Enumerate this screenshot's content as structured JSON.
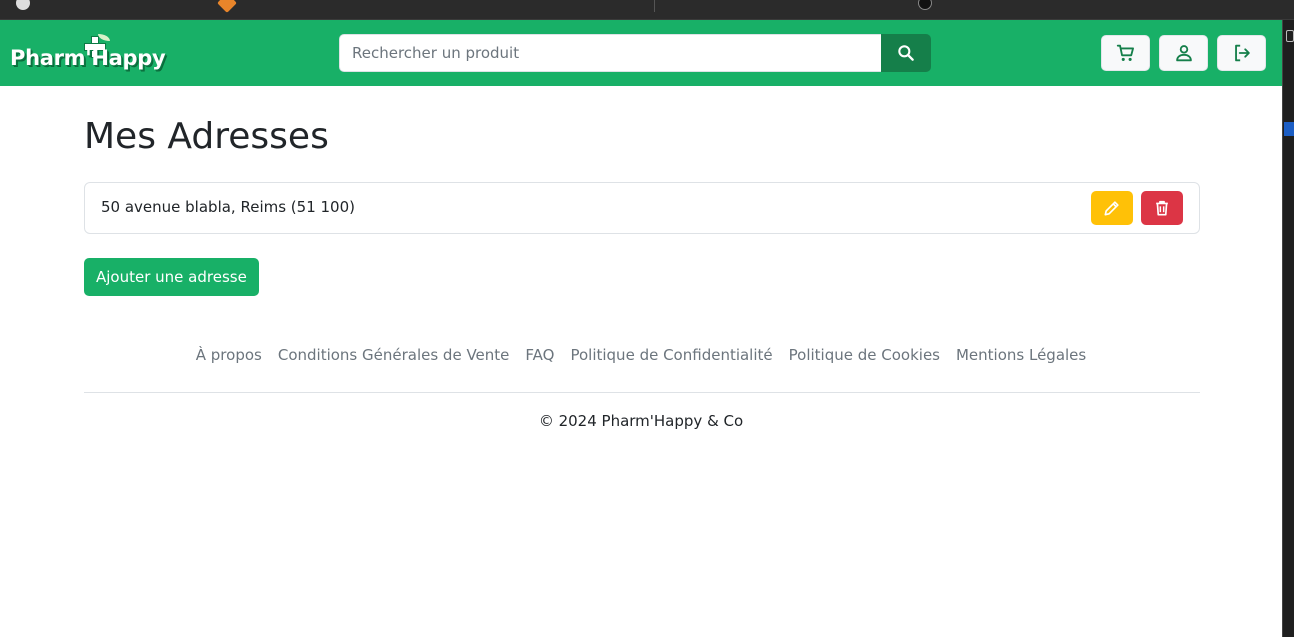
{
  "navbar": {
    "logo_text": "Pharm'Happy",
    "search_placeholder": "Rechercher un produit",
    "icons": {
      "search": "search-icon",
      "cart": "cart-icon",
      "account": "user-icon",
      "logout": "logout-icon"
    }
  },
  "main": {
    "title": "Mes Adresses",
    "addresses": [
      {
        "text": "50 avenue blabla, Reims (51 100)"
      }
    ],
    "add_button_label": "Ajouter une adresse"
  },
  "footer": {
    "links": [
      "À propos",
      "Conditions Générales de Vente",
      "FAQ",
      "Politique de Confidentialité",
      "Politique de Cookies",
      "Mentions Légales"
    ],
    "copyright": "© 2024 Pharm'Happy & Co"
  },
  "colors": {
    "brand_green": "#18b067",
    "search_button": "#157f4a",
    "edit_yellow": "#ffc107",
    "delete_red": "#dc3545"
  }
}
